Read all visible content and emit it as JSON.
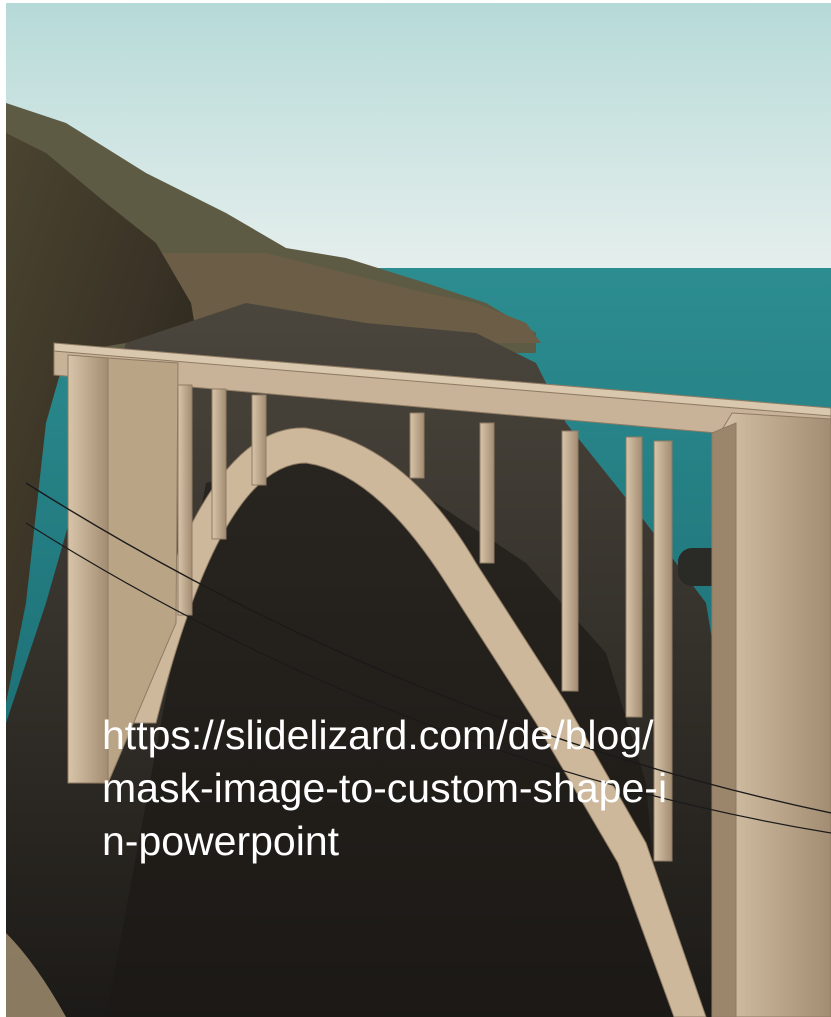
{
  "caption": {
    "text": "https://slidelizard.com/de/blog/mask-image-to-custom-shape-in-powerpoint"
  },
  "colors": {
    "sky_top": "#b8dcd9",
    "sky_horizon": "#e3eeec",
    "ocean": "#2b8c90",
    "ocean_deep": "#1b6f74",
    "cliff_dark": "#2f2a21",
    "cliff_mid": "#6b5a42",
    "hill_far": "#5c5a45",
    "concrete": "#c9b59b",
    "concrete_shadow": "#8f7b64",
    "caption": "#ffffff"
  }
}
